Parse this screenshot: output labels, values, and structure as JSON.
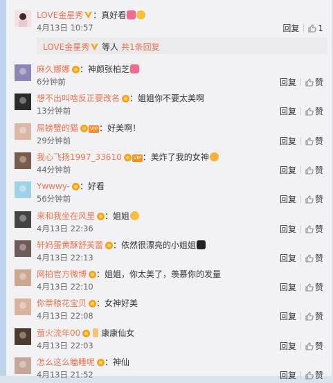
{
  "main_comment": {
    "user": "LOVE金星秀",
    "text": "：真好看",
    "time": "4月13日 10:57",
    "reply_label": "回复",
    "like_count": "1"
  },
  "reply_summary": {
    "user": "LOVE金星秀",
    "middle": "等人",
    "link": "共1条回复"
  },
  "labels": {
    "reply": "回复",
    "like": "赞",
    "vip_tag": "VIP"
  },
  "comments": [
    {
      "user": "麻久娜娜",
      "text": "：神颜张柏芝",
      "time": "6分钟前",
      "tag": false,
      "emoji": "heart"
    },
    {
      "user": "想不出叫啥反正要改名",
      "text": "：姐姐你不要太美啊",
      "time": "13分钟前",
      "tag": false,
      "emoji": ""
    },
    {
      "user": "屌螃蟹的猫",
      "text": "：好美啊！",
      "time": "29分钟前",
      "tag": true,
      "emoji": ""
    },
    {
      "user": "我心飞扬1997_33610",
      "text": "：美炸了我的女神",
      "time": "44分钟前",
      "tag": true,
      "emoji": "kiss"
    },
    {
      "user": "Ywwwy-",
      "text": "：好看",
      "time": "56分钟前",
      "tag": false,
      "emoji": ""
    },
    {
      "user": "来和我坐在风里",
      "text": "：姐姐",
      "time": "4月13日 22:36",
      "tag": false,
      "emoji": "smile"
    },
    {
      "user": "轩妈蛋黄酥舒芙蕾",
      "text": "：依然很漂亮的小姐姐",
      "time": "4月13日 22:13",
      "tag": false,
      "emoji": "blackheart"
    },
    {
      "user": "网拍官方微博",
      "text": "：姐姐，你太美了，羡慕你的发量",
      "time": "4月13日 22:10",
      "tag": false,
      "emoji": ""
    },
    {
      "user": "你萘稂花宝贝",
      "text": "：女神好美",
      "time": "4月13日 22:08",
      "tag": false,
      "emoji": ""
    },
    {
      "user": "萤火流年00",
      "text": "康康仙女",
      "time": "4月13日 22:03",
      "tag": false,
      "emoji": "candle"
    },
    {
      "user": "怎么这么瞌睡呢",
      "text": "：神仙",
      "time": "4月13日 21:52",
      "tag": false,
      "emoji": ""
    }
  ],
  "colors": {
    "username": "#eb7350",
    "panel_bg": "#f2f2f5",
    "badge": "#f7a21b"
  }
}
